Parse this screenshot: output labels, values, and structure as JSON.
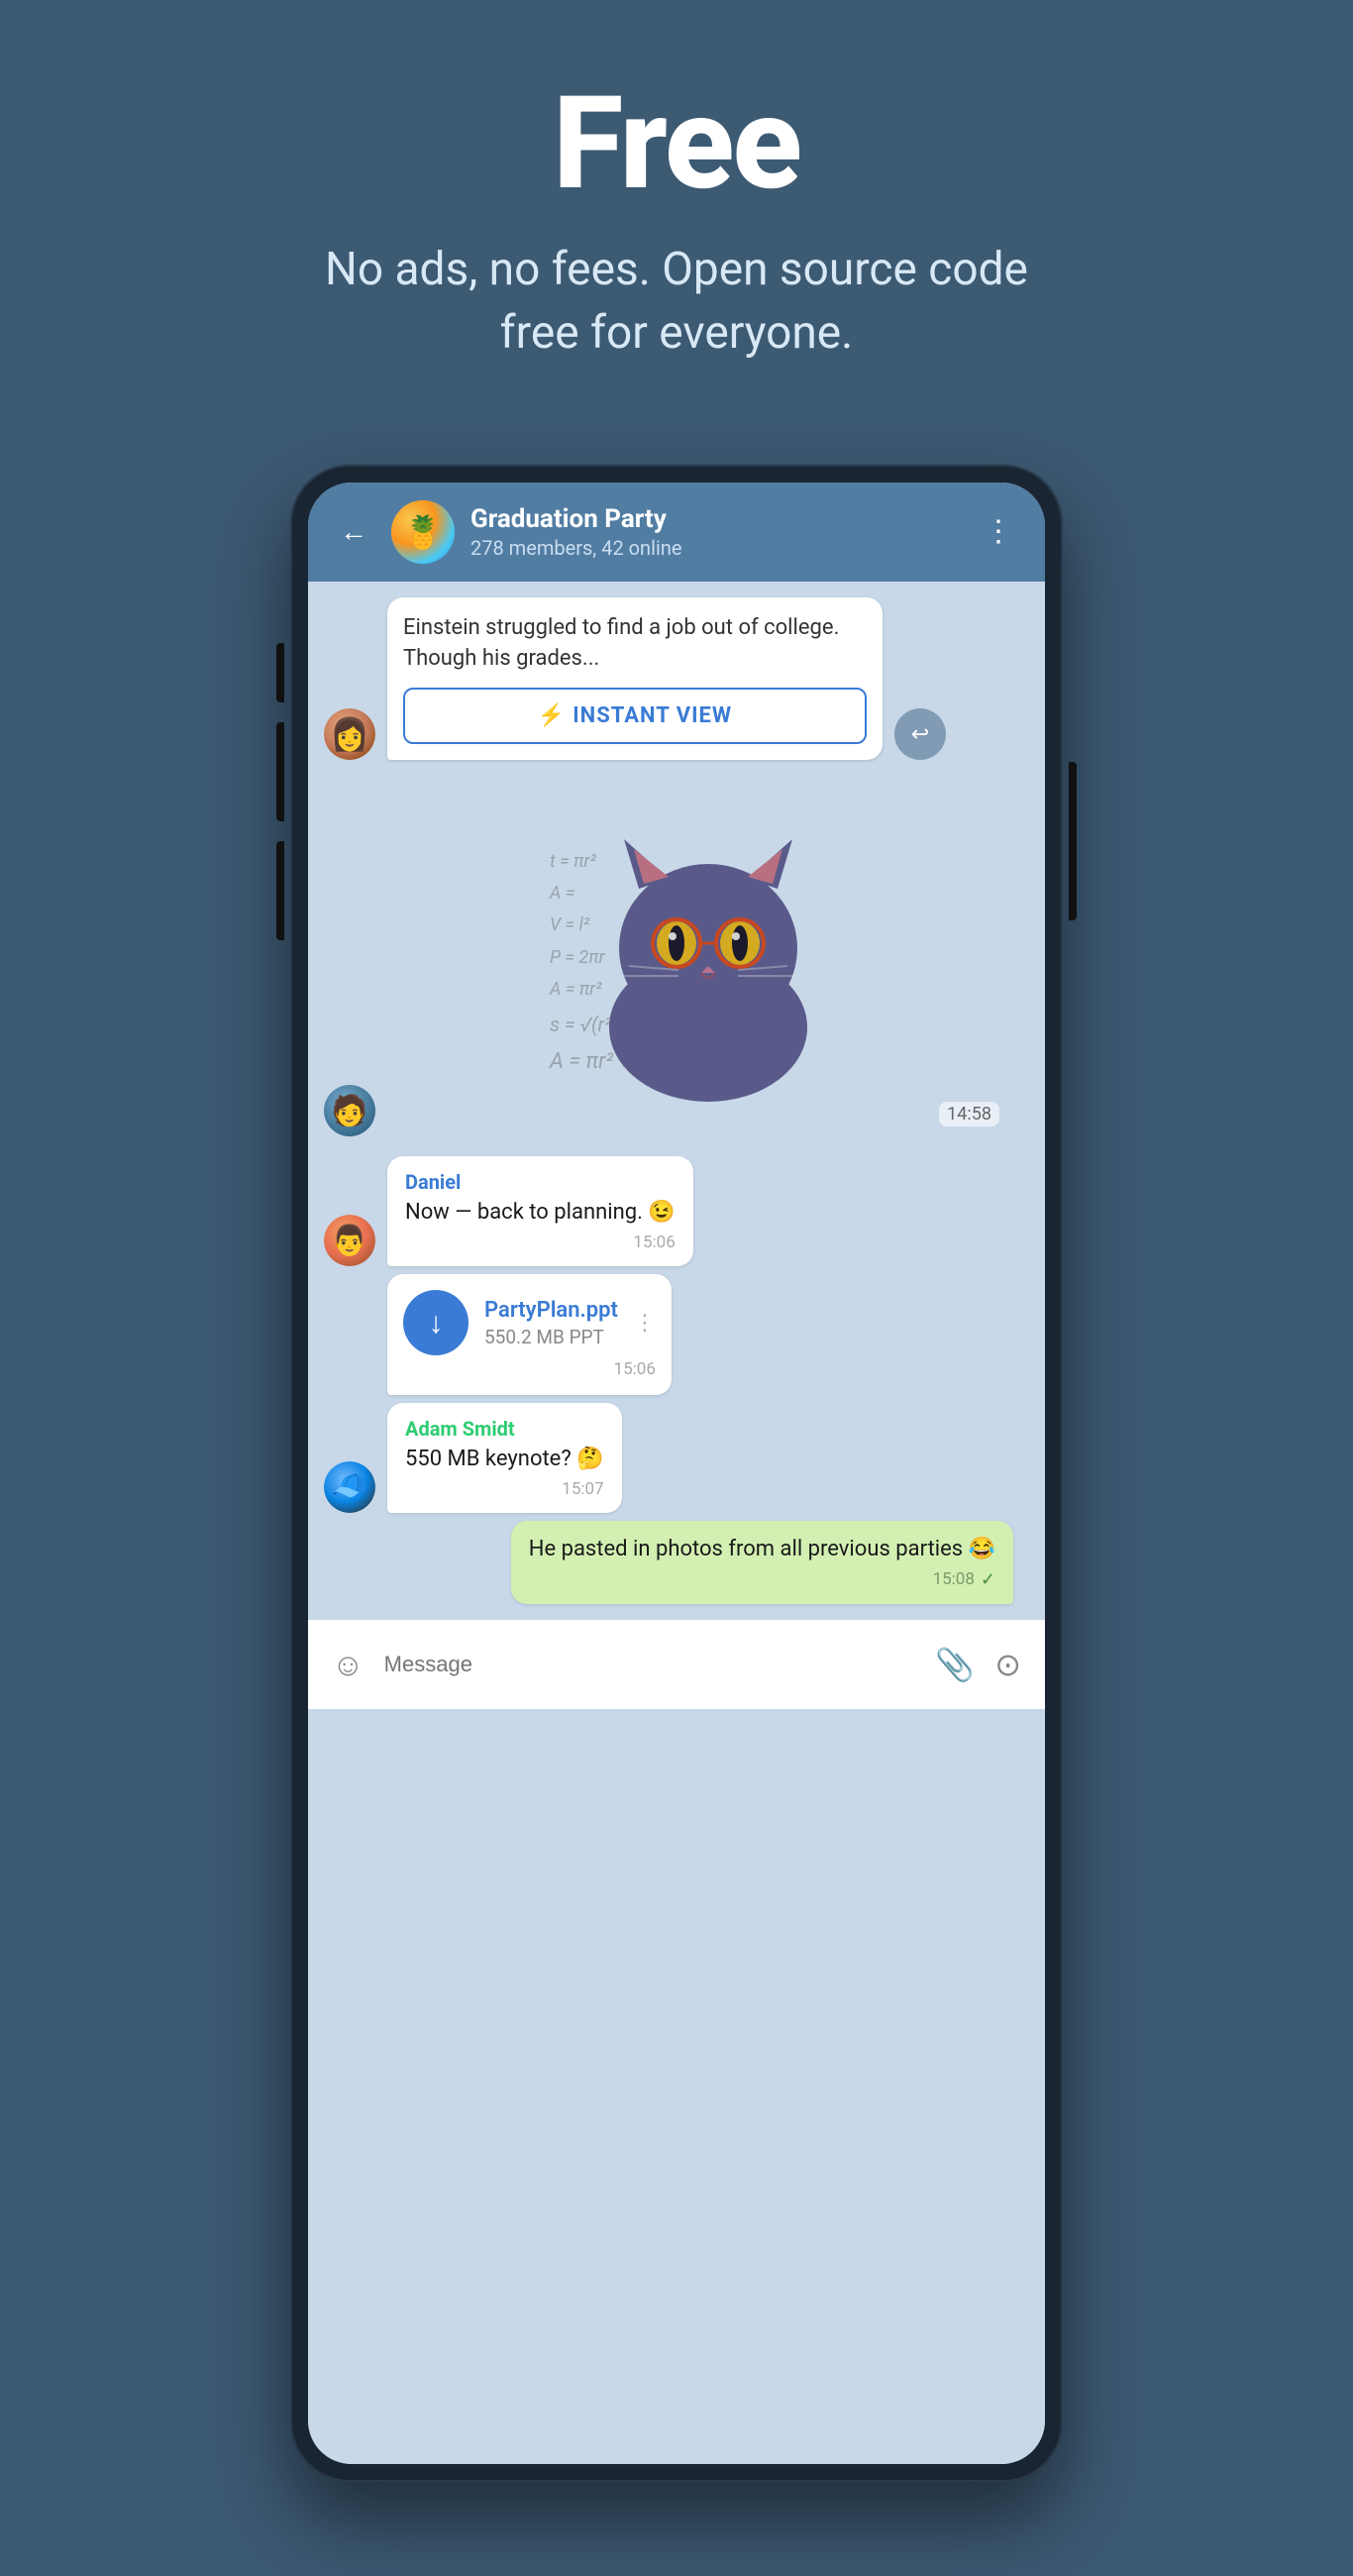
{
  "hero": {
    "title": "Free",
    "subtitle": "No ads, no fees. Open source code free for everyone."
  },
  "chat": {
    "header": {
      "back_label": "←",
      "group_name": "Graduation Party",
      "members_info": "278 members, 42 online",
      "more_icon": "⋮"
    },
    "article": {
      "text": "Einstein struggled to find a job out of college. Though his grades...",
      "instant_view_label": "INSTANT VIEW",
      "instant_view_icon": "⚡"
    },
    "sticker": {
      "time": "14:58"
    },
    "messages": [
      {
        "sender": "Daniel",
        "text": "Now — back to planning. 😉",
        "time": "15:06"
      }
    ],
    "file": {
      "name": "PartyPlan.ppt",
      "size": "550.2 MB PPT",
      "time": "15:06",
      "download_icon": "↓",
      "more_icon": "⋮"
    },
    "adam_message": {
      "sender": "Adam Smidt",
      "text": "550 MB keynote? 🤔",
      "time": "15:07"
    },
    "own_message": {
      "text": "He pasted in photos from all previous parties 😂",
      "time": "15:08",
      "checkmark": "✓"
    },
    "input_bar": {
      "placeholder": "Message",
      "emoji_icon": "☺",
      "attach_icon": "📎",
      "camera_icon": "⊙"
    }
  }
}
